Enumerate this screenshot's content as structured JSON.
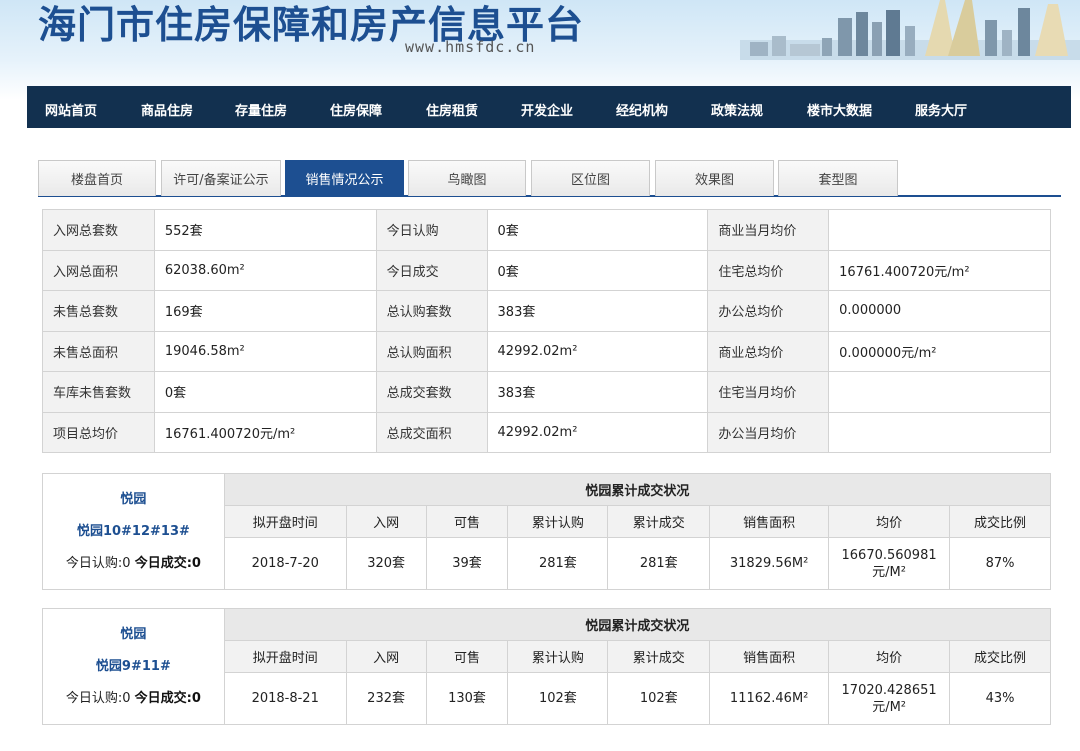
{
  "header": {
    "title": "海门市住房保障和房产信息平台",
    "url": "www.hmsfdc.cn"
  },
  "nav": [
    "网站首页",
    "商品住房",
    "存量住房",
    "住房保障",
    "住房租赁",
    "开发企业",
    "经纪机构",
    "政策法规",
    "楼市大数据",
    "服务大厅"
  ],
  "tabs": [
    "楼盘首页",
    "许可/备案证公示",
    "销售情况公示",
    "鸟瞰图",
    "区位图",
    "效果图",
    "套型图"
  ],
  "active_tab": 2,
  "summary": [
    [
      {
        "k": "入网总套数",
        "v": "552套"
      },
      {
        "k": "今日认购",
        "v": "0套"
      },
      {
        "k": "商业当月均价",
        "v": ""
      }
    ],
    [
      {
        "k": "入网总面积",
        "v": "62038.60m²"
      },
      {
        "k": "今日成交",
        "v": "0套"
      },
      {
        "k": "住宅总均价",
        "v": "16761.400720元/m²"
      }
    ],
    [
      {
        "k": "未售总套数",
        "v": "169套"
      },
      {
        "k": "总认购套数",
        "v": "383套"
      },
      {
        "k": "办公总均价",
        "v": "0.000000"
      }
    ],
    [
      {
        "k": "未售总面积",
        "v": "19046.58m²"
      },
      {
        "k": "总认购面积",
        "v": "42992.02m²"
      },
      {
        "k": "商业总均价",
        "v": "0.000000元/m²"
      }
    ],
    [
      {
        "k": "车库未售套数",
        "v": "0套"
      },
      {
        "k": "总成交套数",
        "v": "383套"
      },
      {
        "k": "住宅当月均价",
        "v": ""
      }
    ],
    [
      {
        "k": "项目总均价",
        "v": "16761.400720元/m²"
      },
      {
        "k": "总成交面积",
        "v": "42992.02m²"
      },
      {
        "k": "办公当月均价",
        "v": ""
      }
    ]
  ],
  "projects": [
    {
      "name": "悦园",
      "buildings": "悦园10#12#13#",
      "today_sub_label": "今日认购:0",
      "today_deal_label": "今日成交:0",
      "table_title": "悦园累计成交状况",
      "headers": [
        "拟开盘时间",
        "入网",
        "可售",
        "累计认购",
        "累计成交",
        "销售面积",
        "均价",
        "成交比例"
      ],
      "values": [
        "2018-7-20",
        "320套",
        "39套",
        "281套",
        "281套",
        "31829.56M²",
        "16670.560981元/M²",
        "87%"
      ]
    },
    {
      "name": "悦园",
      "buildings": "悦园9#11#",
      "today_sub_label": "今日认购:0",
      "today_deal_label": "今日成交:0",
      "table_title": "悦园累计成交状况",
      "headers": [
        "拟开盘时间",
        "入网",
        "可售",
        "累计认购",
        "累计成交",
        "销售面积",
        "均价",
        "成交比例"
      ],
      "values": [
        "2018-8-21",
        "232套",
        "130套",
        "102套",
        "102套",
        "11162.46M²",
        "17020.428651元/M²",
        "43%"
      ]
    }
  ]
}
